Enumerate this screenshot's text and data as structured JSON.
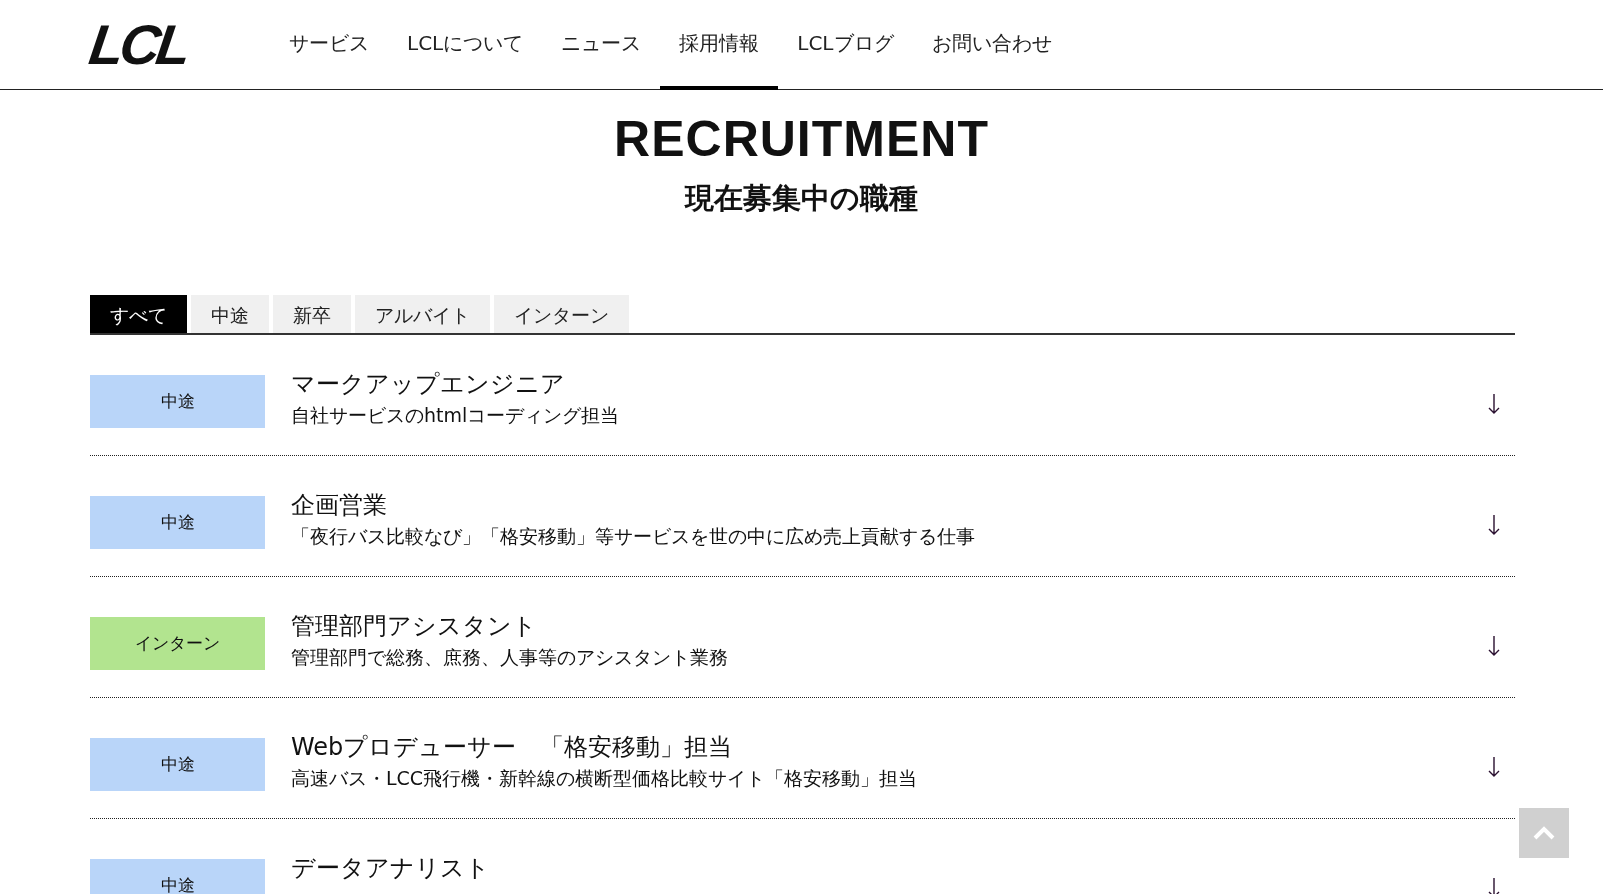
{
  "header": {
    "logo": "LCL",
    "nav": [
      {
        "label": "サービス",
        "selected": false
      },
      {
        "label": "LCLについて",
        "selected": false
      },
      {
        "label": "ニュース",
        "selected": false
      },
      {
        "label": "採用情報",
        "selected": true
      },
      {
        "label": "LCLブログ",
        "selected": false
      },
      {
        "label": "お問い合わせ",
        "selected": false
      }
    ]
  },
  "heading": {
    "title": "RECRUITMENT",
    "subtitle": "現在募集中の職種"
  },
  "tabs": [
    {
      "label": "すべて",
      "selected": true
    },
    {
      "label": "中途",
      "selected": false
    },
    {
      "label": "新卒",
      "selected": false
    },
    {
      "label": "アルバイト",
      "selected": false
    },
    {
      "label": "インターン",
      "selected": false
    }
  ],
  "jobs": [
    {
      "tag": "中途",
      "color": "#b9d5f9",
      "title": "マークアップエンジニア",
      "description": "自社サービスのhtmlコーディング担当"
    },
    {
      "tag": "中途",
      "color": "#b9d5f9",
      "title": "企画営業",
      "description": "「夜行バス比較なび」「格安移動」等サービスを世の中に広め売上貢献する仕事"
    },
    {
      "tag": "インターン",
      "color": "#b2e48f",
      "title": "管理部門アシスタント",
      "description": "管理部門で総務、庶務、人事等のアシスタント業務"
    },
    {
      "tag": "中途",
      "color": "#b9d5f9",
      "title": "Webプロデューサー　「格安移動」担当",
      "description": "高速バス・LCC飛行機・新幹線の横断型価格比較サイト「格安移動」担当"
    },
    {
      "tag": "中途",
      "color": "#b9d5f9",
      "title": "データアナリスト"
    }
  ]
}
